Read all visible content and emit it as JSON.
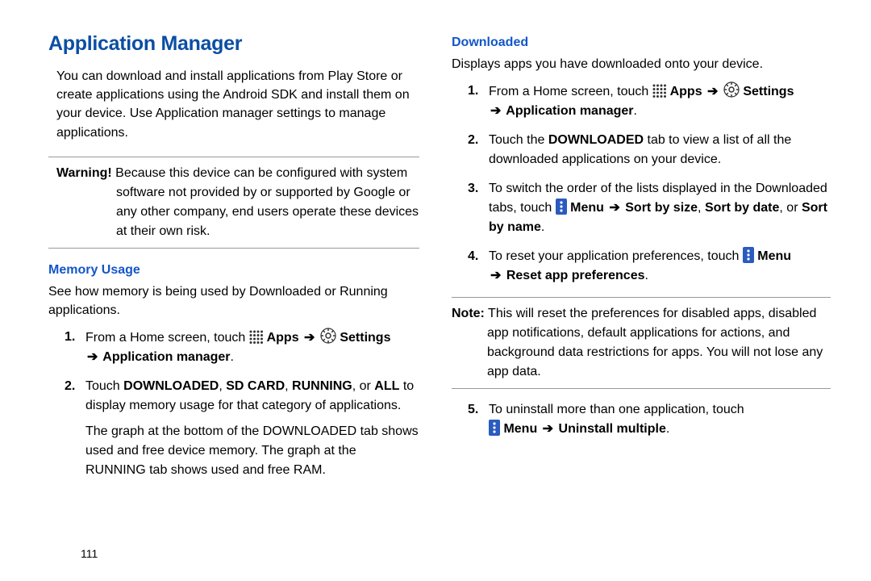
{
  "left": {
    "title": "Application Manager",
    "intro": "You can download and install applications from Play Store or create applications using the Android SDK and install them on your device. Use Application manager settings to manage applications.",
    "warning_label": "Warning!",
    "warning_body": " Because this device can be configured with system software not provided by or supported by Google or any other company, end users operate these devices at their own risk.",
    "memory_head": "Memory Usage",
    "memory_intro": "See how memory is being used by Downloaded or Running applications.",
    "s1_a": "From a Home screen, touch ",
    "s1_apps": " Apps ",
    "s1_settings": " Settings ",
    "s1_appmgr": " Application manager",
    "s1_dot": ".",
    "s2_a": "Touch ",
    "s2_b": "DOWNLOADED",
    "s2_c": ", ",
    "s2_d": "SD CARD",
    "s2_e": ", ",
    "s2_f": "RUNNING",
    "s2_g": ", or ",
    "s2_h": "ALL",
    "s2_i": " to display memory usage for that category of applications.",
    "followup": "The graph at the bottom of the DOWNLOADED tab shows used and free device memory. The graph at the RUNNING tab shows used and free RAM."
  },
  "right": {
    "dl_head": "Downloaded",
    "dl_intro": "Displays apps you have downloaded onto your device.",
    "r1_a": "From a Home screen, touch ",
    "r1_apps": " Apps ",
    "r1_settings": " Settings ",
    "r1_appmgr": " Application manager",
    "r1_dot": ".",
    "r2_a": "Touch the ",
    "r2_b": "DOWNLOADED",
    "r2_c": " tab to view a list of all the downloaded applications on your device.",
    "r3_a": "To switch the order of the lists displayed in the Downloaded tabs, touch ",
    "r3_menu": " Menu ",
    "r3_size": " Sort by size",
    "r3_comma": ", ",
    "r3_date": "Sort by date",
    "r3_or": ", or ",
    "r3_name": "Sort by name",
    "r3_dot": ".",
    "r4_a": "To reset your application preferences, touch ",
    "r4_menu": " Menu ",
    "r4_reset": " Reset app preferences",
    "r4_dot": ".",
    "note_label": "Note:",
    "note_body": " This will reset the preferences for disabled apps, disabled app notifications, default applications for actions, and background data restrictions for apps. You will not lose any app data.",
    "r5_a": "To uninstall more than one application, touch ",
    "r5_menu": " Menu ",
    "r5_uninst": " Uninstall multiple",
    "r5_dot": "."
  },
  "page_number": "111"
}
